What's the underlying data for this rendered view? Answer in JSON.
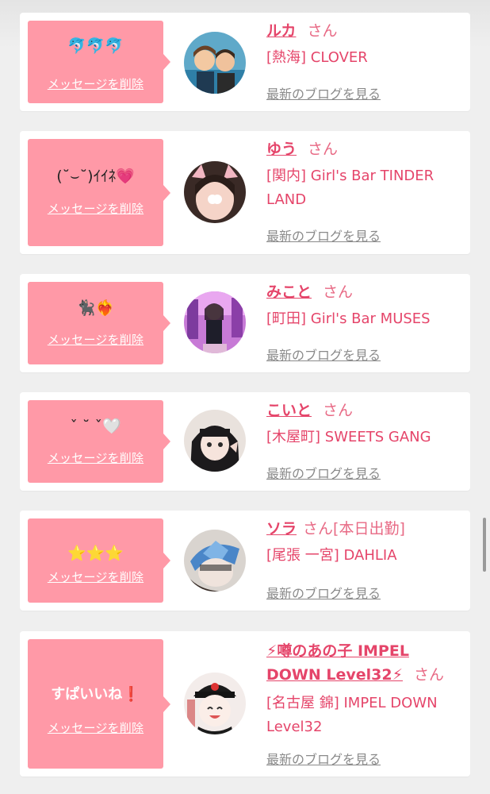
{
  "delete_label": "メッセージを削除",
  "blog_label": "最新のブログを見る",
  "honorific": "さん",
  "colors": {
    "bubble": "#ff99a7",
    "accent": "#e5456a",
    "card_bg": "#ffffff",
    "page_bg": "#efefef",
    "muted_link": "#8a8a8a"
  },
  "entries": [
    {
      "message": "🐬🐬🐬",
      "name": "ルカ",
      "status": "",
      "shop": "[熱海] CLOVER",
      "avatar_icon": "avatar-photo-icon"
    },
    {
      "message": "(˘⌣˘)ｲｲﾈ💗",
      "name": "ゆう",
      "status": "",
      "shop": "[関内] Girl's Bar TINDER LAND",
      "avatar_icon": "avatar-photo-icon"
    },
    {
      "message": "🐈‍⬛❤️‍🔥",
      "name": "みこと",
      "status": "",
      "shop": "[町田] Girl's Bar MUSES",
      "avatar_icon": "avatar-photo-icon"
    },
    {
      "message": "ˇ ˘ ˇ🤍",
      "name": "こいと",
      "status": "",
      "shop": "[木屋町] SWEETS GANG",
      "avatar_icon": "avatar-photo-icon"
    },
    {
      "message": "⭐⭐⭐",
      "name": "ソラ",
      "status": "[本日出勤]",
      "shop": "[尾張 一宮] DAHLIA",
      "avatar_icon": "avatar-photo-icon"
    },
    {
      "message": "すぱいいね❗",
      "name": "⚡噂のあの子 IMPEL DOWN Level32⚡",
      "status": "",
      "shop": "[名古屋 錦] IMPEL DOWN Level32",
      "avatar_icon": "avatar-photo-icon"
    }
  ]
}
